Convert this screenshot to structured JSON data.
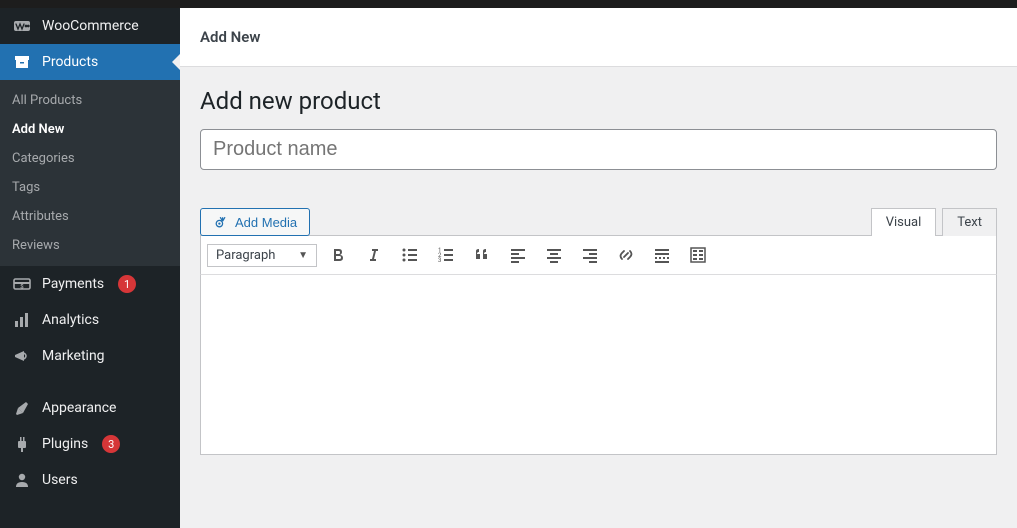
{
  "sidebar": {
    "items": [
      {
        "key": "woocommerce",
        "label": "WooCommerce",
        "active": false
      },
      {
        "key": "products",
        "label": "Products",
        "active": true
      },
      {
        "key": "payments",
        "label": "Payments",
        "badge": 1
      },
      {
        "key": "analytics",
        "label": "Analytics"
      },
      {
        "key": "marketing",
        "label": "Marketing"
      },
      {
        "key": "appearance",
        "label": "Appearance"
      },
      {
        "key": "plugins",
        "label": "Plugins",
        "badge": 3
      },
      {
        "key": "users",
        "label": "Users"
      }
    ],
    "submenu": {
      "items": [
        {
          "label": "All Products"
        },
        {
          "label": "Add New",
          "current": true
        },
        {
          "label": "Categories"
        },
        {
          "label": "Tags"
        },
        {
          "label": "Attributes"
        },
        {
          "label": "Reviews"
        }
      ]
    }
  },
  "header": {
    "title": "Add New"
  },
  "page": {
    "title": "Add new product",
    "title_input": {
      "value": "",
      "placeholder": "Product name"
    }
  },
  "editor": {
    "add_media": "Add Media",
    "tabs": {
      "visual": "Visual",
      "text": "Text",
      "active": "visual"
    },
    "format_selected": "Paragraph",
    "toolbar_buttons": [
      "bold",
      "italic",
      "bulleted-list",
      "numbered-list",
      "blockquote",
      "align-left",
      "align-center",
      "align-right",
      "link",
      "read-more",
      "toolbar-toggle"
    ]
  }
}
